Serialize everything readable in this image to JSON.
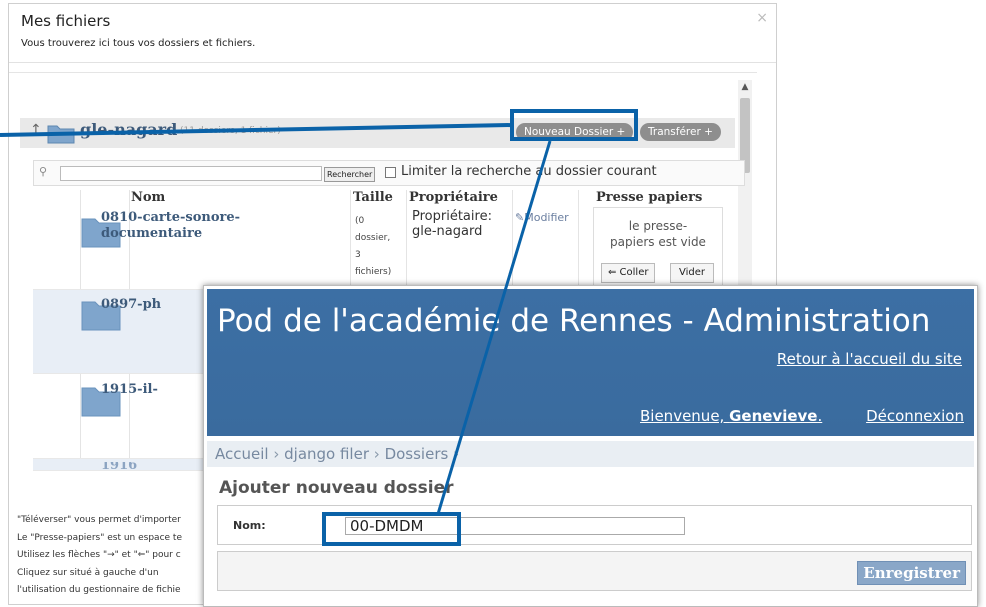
{
  "dialog": {
    "title": "Mes fichiers",
    "subtitle": "Vous trouverez ici tous vos dossiers et fichiers.",
    "close_glyph": "×"
  },
  "folder_header": {
    "up_glyph": "↑",
    "name": "gle-nagard",
    "count": "(11 dossiers, 1 fichier)",
    "new_folder_label": "Nouveau Dossier +",
    "upload_label": "Transférer +"
  },
  "search": {
    "icon": "search-icon",
    "value": "",
    "button_label": "Rechercher",
    "limit_label": "Limiter la recherche au dossier courant"
  },
  "table": {
    "columns": [
      "Nom",
      "Taille",
      "Propriétaire",
      "Presse papiers"
    ],
    "rows": [
      {
        "name_line1": "0810-carte-sonore-",
        "name_line2": "documentaire",
        "size_lines": [
          "(0",
          "dossier,",
          "3",
          "fichiers)"
        ],
        "owner_line1": "Propriétaire:",
        "owner_line2": "gle-nagard",
        "edit_label": "Modifier"
      },
      {
        "name_line1": "0897-ph"
      },
      {
        "name_line1": "1915-il-"
      },
      {
        "name_line1": "1916"
      }
    ]
  },
  "clipboard": {
    "empty_line1": "le presse-",
    "empty_line2": "papiers est vide",
    "paste_label": "⇐ Coller",
    "clear_label": "Vider"
  },
  "help_lines": [
    "\"Téléverser\" vous permet d'importer",
    "Le \"Presse-papiers\" est un espace te",
    "Utilisez les flèches \"→\" et \"⇐\" pour c",
    "Cliquez sur    situé à gauche d'un",
    "l'utilisation du gestionnaire de fichie"
  ],
  "admin": {
    "title": "Pod de l'académie de Rennes - Administration",
    "back_link": "Retour à l'accueil du site",
    "welcome_prefix": "Bienvenue, ",
    "user": "Genevieve",
    "welcome_suffix": ".",
    "logout": "Déconnexion",
    "breadcrumbs": [
      "Accueil",
      "django filer",
      "Dossiers"
    ],
    "crumb_sep": "›",
    "form_title": "Ajouter nouveau dossier",
    "field_label": "Nom:",
    "field_value": "00-DMDM",
    "save_label": "Enregistrer"
  },
  "colors": {
    "accent_callout": "#0a62a8",
    "admin_header": "#3c6fa4",
    "folder_blue": "#7fa5cc"
  }
}
